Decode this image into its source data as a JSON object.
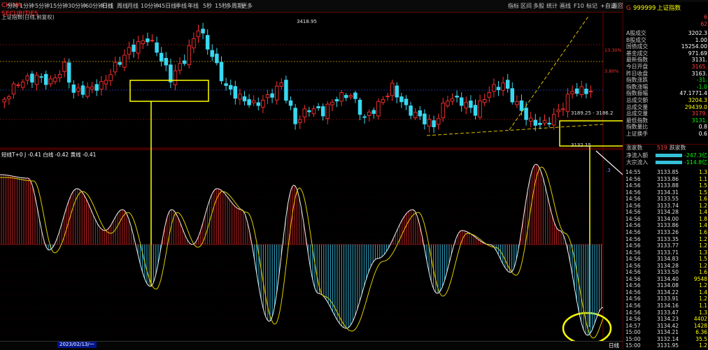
{
  "app": {
    "logo_text": "CHINA SECURITIES"
  },
  "toolbar": {
    "timeframes": [
      "分时",
      "1分钟",
      "5分钟",
      "15分钟",
      "30分钟",
      "60分钟",
      "日线",
      "周线",
      "月线",
      "10分钟",
      "45日线",
      "季线",
      "年线",
      "5秒",
      "15秒",
      "多周期",
      "更多"
    ],
    "active_timeframe": "日线",
    "tools": [
      "指标",
      "区间",
      "多股",
      "统计",
      "画线",
      "F10",
      "标记",
      "+自选",
      "返回"
    ],
    "window_controls": [
      "_",
      "□",
      "×"
    ]
  },
  "chart": {
    "title": "上证指数(日线,前复权)",
    "high_label": "3418.95",
    "range_label": "3189.25 - 3186.2",
    "low_label": "3132.15",
    "price_ticks": [
      "13.30%",
      "3.80%"
    ],
    "indicator_title": "短线T+0 J -0.41  白线 -0.42  黄线 -0.41",
    "indicator_right_label": ".3",
    "bottom_date": "2023/02/13/一",
    "bottom_tab": "日线"
  },
  "right_panel": {
    "code": "999999",
    "name": "上证指数",
    "prefix": "G",
    "corner_values": [
      "6",
      "62"
    ],
    "quotes": [
      {
        "label": "A股成交",
        "value": "3202.3",
        "color": "#ffffff"
      },
      {
        "label": "B股成交",
        "value": "1.00",
        "color": "#ffffff"
      },
      {
        "label": "国债成交",
        "value": "15254.00",
        "color": "#ffffff"
      },
      {
        "label": "基金成交",
        "value": "971.69",
        "color": "#ffffff"
      },
      {
        "label": "最新指数",
        "value": "3131.",
        "color": "#ffffff"
      },
      {
        "label": "今日开盘",
        "value": "3165.",
        "color": "#ff4040"
      },
      {
        "label": "昨日收盘",
        "value": "3163.",
        "color": "#ffffff"
      },
      {
        "label": "指数涨跌",
        "value": "-31.",
        "color": "#00ff00"
      },
      {
        "label": "指数涨幅",
        "value": "-1.0",
        "color": "#00ff00"
      },
      {
        "label": "指数振幅",
        "value": "47.1771.4",
        "color": "#ffffff"
      },
      {
        "label": "总成交额",
        "value": "3204.3",
        "color": "#ffff00"
      },
      {
        "label": "总成交量",
        "value": "29439.0",
        "color": "#ffff00"
      },
      {
        "label": "总成交量",
        "value": "3179.",
        "color": "#ff4040"
      },
      {
        "label": "最低指数",
        "value": "3131.",
        "color": "#00ff00"
      },
      {
        "label": "指数量比",
        "value": "0.8",
        "color": "#ffffff"
      },
      {
        "label": "上证换手",
        "value": "0.6",
        "color": "#ffffff"
      }
    ],
    "updown_label": "涨家数",
    "updown_value": "519",
    "down_label": "跌家数",
    "flows": [
      {
        "label": "净流入额",
        "value": "-247.3亿"
      },
      {
        "label": "大宗流入",
        "value": "-114.8亿"
      }
    ],
    "ticks": [
      {
        "t": "14:55",
        "p": "3133.85",
        "v": "1.3"
      },
      {
        "t": "14:56",
        "p": "3133.86",
        "v": "1.1"
      },
      {
        "t": "14:56",
        "p": "3133.88",
        "v": "1.5"
      },
      {
        "t": "14:56",
        "p": "3134.31",
        "v": "1.5"
      },
      {
        "t": "14:56",
        "p": "3133.55",
        "v": "1.6"
      },
      {
        "t": "14:56",
        "p": "3133.74",
        "p2": "",
        "v": "1.2"
      },
      {
        "t": "14:56",
        "p": "3134.28",
        "v": "1.4"
      },
      {
        "t": "14:56",
        "p": "3134.00",
        "v": "1.8"
      },
      {
        "t": "14:56",
        "p": "3133.86",
        "v": "1.4"
      },
      {
        "t": "14:56",
        "p": "3133.26",
        "v": "1.6"
      },
      {
        "t": "14:56",
        "p": "3133.35",
        "v": "1.2"
      },
      {
        "t": "14:56",
        "p": "3133.77",
        "v": "1.2"
      },
      {
        "t": "14:56",
        "p": "3133.71",
        "v": "1.3"
      },
      {
        "t": "14:56",
        "p": "3134.83",
        "v": "1.5"
      },
      {
        "t": "14:56",
        "p": "3134.28",
        "v": "1.2"
      },
      {
        "t": "14:56",
        "p": "3133.50",
        "v": "1.6"
      },
      {
        "t": "14:56",
        "p": "3134.40",
        "v": "9548"
      },
      {
        "t": "14:56",
        "p": "3134.08",
        "v": "1.2"
      },
      {
        "t": "14:56",
        "p": "3134.22",
        "v": "1.4"
      },
      {
        "t": "14:56",
        "p": "3133.91",
        "v": "1.2"
      },
      {
        "t": "14:56",
        "p": "3134.16",
        "v": "1.1"
      },
      {
        "t": "14:56",
        "p": "3133.47",
        "v": "1.3"
      },
      {
        "t": "14:56",
        "p": "3134.23",
        "v": "4402"
      },
      {
        "t": "14:57",
        "p": "3134.42",
        "v": "1428"
      },
      {
        "t": "15:00",
        "p": "3134.21",
        "v": "6.36"
      },
      {
        "t": "15:00",
        "p": "3132.14",
        "v": "35.5"
      },
      {
        "t": "15:00",
        "p": "3131.95",
        "v": "1.2"
      }
    ]
  }
}
